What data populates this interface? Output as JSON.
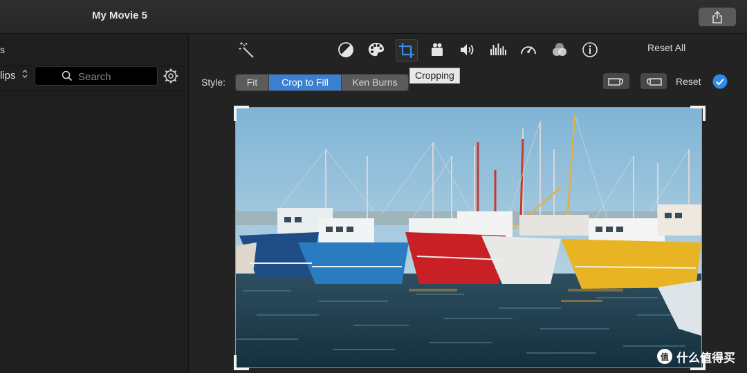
{
  "window": {
    "title": "My Movie 5"
  },
  "library": {
    "header_fragment": "s",
    "clips_label": "lips",
    "search": {
      "placeholder": "Search",
      "value": ""
    }
  },
  "toolbar": {
    "tools": [
      {
        "name": "enhance",
        "icon": "magic-wand-icon"
      },
      {
        "name": "color-balance",
        "icon": "color-balance-icon"
      },
      {
        "name": "color-correction",
        "icon": "palette-icon"
      },
      {
        "name": "cropping",
        "icon": "crop-icon",
        "active": true
      },
      {
        "name": "stabilization",
        "icon": "video-camera-icon"
      },
      {
        "name": "volume",
        "icon": "speaker-icon"
      },
      {
        "name": "noise-reduction",
        "icon": "equalizer-icon"
      },
      {
        "name": "speed",
        "icon": "speedometer-icon"
      },
      {
        "name": "clip-filter",
        "icon": "filter-circles-icon"
      },
      {
        "name": "clip-info",
        "icon": "info-icon"
      }
    ],
    "reset_all_label": "Reset All"
  },
  "crop": {
    "style_label": "Style:",
    "styles": [
      "Fit",
      "Crop to Fill",
      "Ken Burns"
    ],
    "selected_style": "Crop to Fill",
    "tooltip": "Cropping",
    "reset_label": "Reset"
  },
  "watermark": {
    "badge": "值",
    "text": "什么值得买"
  },
  "colors": {
    "accent": "#3b7fd0",
    "background": "#232323",
    "apply_check": "#2f8be6"
  }
}
